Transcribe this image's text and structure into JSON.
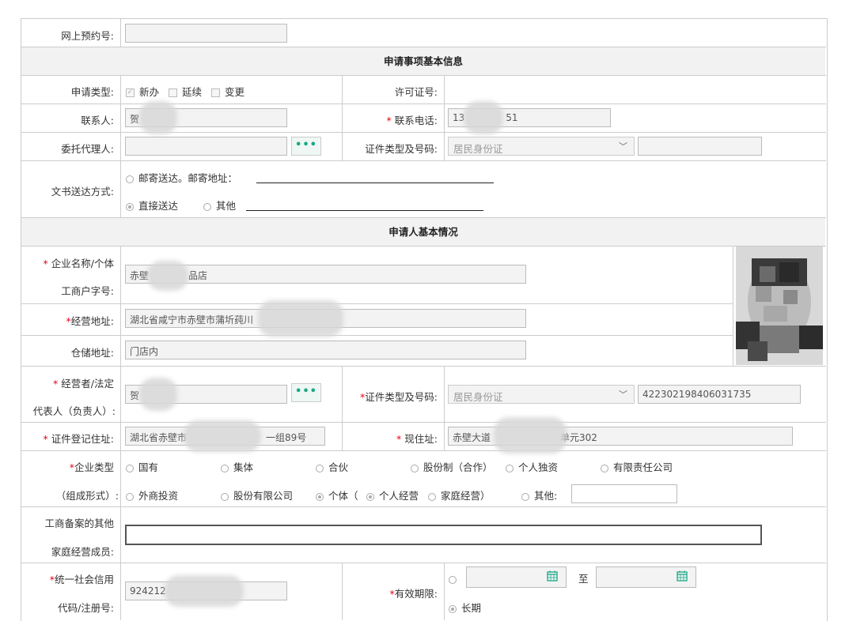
{
  "rows": {
    "appointment_label": "网上预约号:",
    "section1_title": "申请事项基本信息",
    "apply_type_label": "申请类型:",
    "apply_options": [
      "新办",
      "延续",
      "变更"
    ],
    "license_no_label": "许可证号:",
    "contact_label": "联系人:",
    "contact_value": "贺",
    "phone_label": "联系电话:",
    "phone_value_start": "13",
    "phone_value_end": "51",
    "agent_label": "委托代理人:",
    "id_type_label": "证件类型及号码:",
    "id_type_value": "居民身份证",
    "delivery_label": "文书送达方式:",
    "delivery_mail": "邮寄送达。邮寄地址：",
    "delivery_direct": "直接送达",
    "delivery_other": "其他",
    "section2_title": "申请人基本情况",
    "company_name_label_1": "企业名称/个体",
    "company_name_label_2": "工商户字号:",
    "company_name_start": "赤壁",
    "company_name_end": "品店",
    "address_label": "经营地址:",
    "address_value": "湖北省咸宁市赤壁市蒲圻莼川",
    "warehouse_label": "仓储地址:",
    "warehouse_value": "门店内",
    "operator_label_1": "经营者/法定",
    "operator_label_2": "代表人（负责人）:",
    "operator_value": "贺",
    "operator_id_label": "证件类型及号码:",
    "operator_id_type": "居民身份证",
    "operator_id_no": "422302198406031735",
    "reg_addr_label": "证件登记住址:",
    "reg_addr_start": "湖北省赤壁市",
    "reg_addr_end": "一组89号",
    "cur_addr_label": "现住址:",
    "cur_addr_start": "赤壁大道",
    "cur_addr_end": "单元302",
    "ent_type_label_1": "企业类型",
    "ent_type_label_2": "（组成形式）:",
    "ent_type_row1": [
      "国有",
      "集体",
      "合伙",
      "股份制（合作）",
      "个人独资",
      "有限责任公司"
    ],
    "ent_type_row2": [
      "外商投资",
      "股份有限公司",
      "个体（",
      "个人经营",
      "家庭经营）",
      "其他:"
    ],
    "family_label_1": "工商备案的其他",
    "family_label_2": "家庭经营成员:",
    "credit_label_1": "统一社会信用",
    "credit_label_2": "代码/注册号:",
    "credit_value": "924212",
    "validity_label": "有效期限:",
    "validity_to": "至",
    "validity_long": "长期",
    "asterisk": "*",
    "dots": "•••"
  },
  "colors": {
    "required": "#e60012",
    "accent": "#1aa886",
    "border": "#cccccc"
  },
  "icons": [
    "calendar-icon",
    "more-dots-icon",
    "dropdown-arrow-icon"
  ]
}
